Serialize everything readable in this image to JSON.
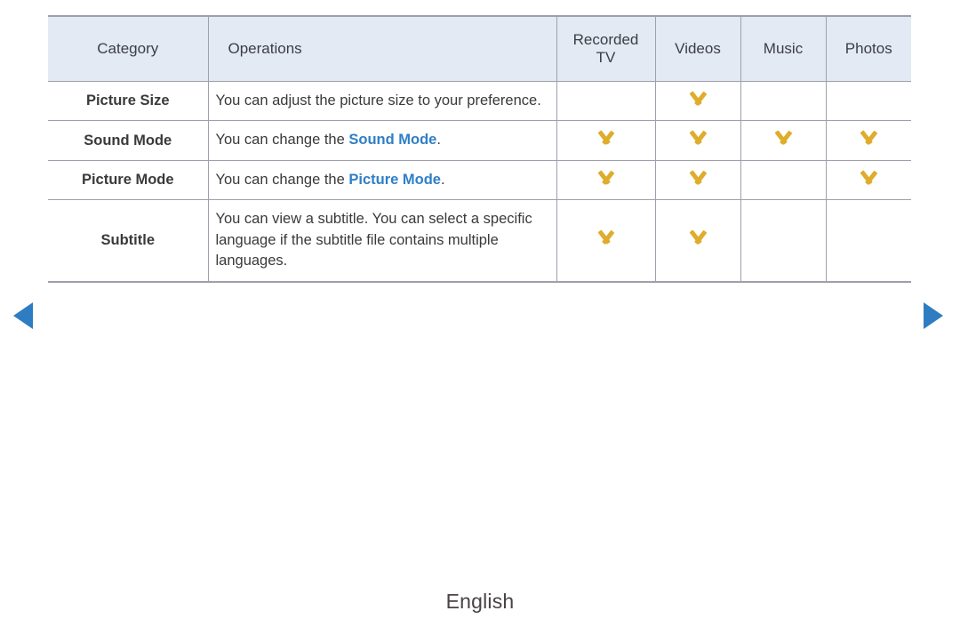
{
  "table": {
    "columns": [
      {
        "key": "category",
        "label": "Category"
      },
      {
        "key": "operations",
        "label": "Operations"
      },
      {
        "key": "recorded_tv",
        "label": "Recorded TV"
      },
      {
        "key": "videos",
        "label": "Videos"
      },
      {
        "key": "music",
        "label": "Music"
      },
      {
        "key": "photos",
        "label": "Photos"
      }
    ],
    "header": {
      "category": "Category",
      "operations": "Operations",
      "recorded_tv_line1": "Recorded",
      "recorded_tv_line2": "TV",
      "videos": "Videos",
      "music": "Music",
      "photos": "Photos"
    },
    "rows": [
      {
        "category": "Picture Size",
        "operations_parts": [
          {
            "text": "You can adjust the picture size to your preference.",
            "highlight": false
          }
        ],
        "operations_plain": "You can adjust the picture size to your preference.",
        "recorded_tv": false,
        "videos": true,
        "music": false,
        "photos": false
      },
      {
        "category": "Sound Mode",
        "operations_parts": [
          {
            "text": "You can change the ",
            "highlight": false
          },
          {
            "text": "Sound Mode",
            "highlight": true
          },
          {
            "text": ".",
            "highlight": false
          }
        ],
        "operations_plain": "You can change the Sound Mode.",
        "recorded_tv": true,
        "videos": true,
        "music": true,
        "photos": true
      },
      {
        "category": "Picture Mode",
        "operations_parts": [
          {
            "text": "You can change the ",
            "highlight": false
          },
          {
            "text": "Picture Mode",
            "highlight": true
          },
          {
            "text": ".",
            "highlight": false
          }
        ],
        "operations_plain": "You can change the Picture Mode.",
        "recorded_tv": true,
        "videos": true,
        "music": false,
        "photos": true
      },
      {
        "category": "Subtitle",
        "operations_parts": [
          {
            "text": "You can view a subtitle. You can select a specific language if the subtitle file contains multiple languages.",
            "highlight": false
          }
        ],
        "operations_plain": "You can view a subtitle. You can select a specific language if the subtitle file contains multiple languages.",
        "recorded_tv": true,
        "videos": true,
        "music": false,
        "photos": false
      }
    ]
  },
  "nav": {
    "prev_label": "Previous page",
    "next_label": "Next page",
    "prev_icon": "triangle-left-icon",
    "next_icon": "triangle-right-icon"
  },
  "footer": {
    "language": "English"
  },
  "icons": {
    "supported": "chevron-down-icon"
  },
  "colors": {
    "header_background": "#e3eaf4",
    "border": "#9ea0ad",
    "accent_blue": "#2f7fc6",
    "chevron_gold": "#dfac2c",
    "arrow_blue": "#2e7dc2",
    "text": "#3a3a3a",
    "footer_text": "#4a4246"
  }
}
